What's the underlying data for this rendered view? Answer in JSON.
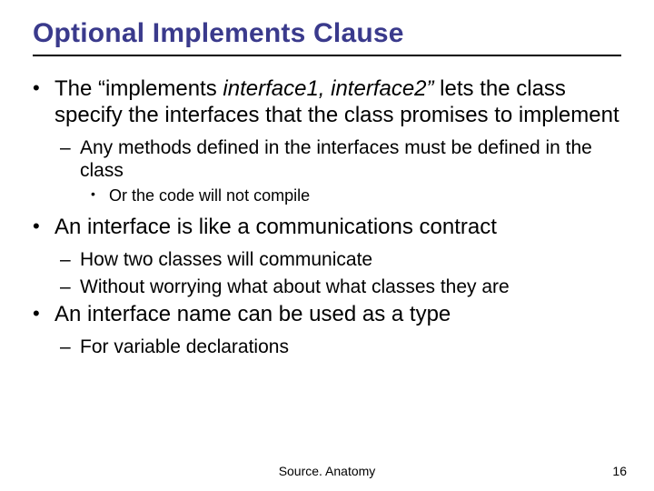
{
  "title": "Optional Implements Clause",
  "bullets": {
    "b1_a": "The “implements ",
    "b1_b": "interface1, interface2”",
    "b1_c": " lets the class specify the interfaces that the class promises to implement",
    "b1_s1": "Any methods defined in the interfaces must be defined in the class",
    "b1_s1_s1": "Or the code will not compile",
    "b2": "An interface is like a communications contract",
    "b2_s1": "How two classes will communicate",
    "b2_s2": "Without worrying what about what classes they are",
    "b3": "An interface name can be used as a type",
    "b3_s1": "For variable declarations"
  },
  "footer": {
    "center": "Source. Anatomy",
    "page": "16"
  }
}
